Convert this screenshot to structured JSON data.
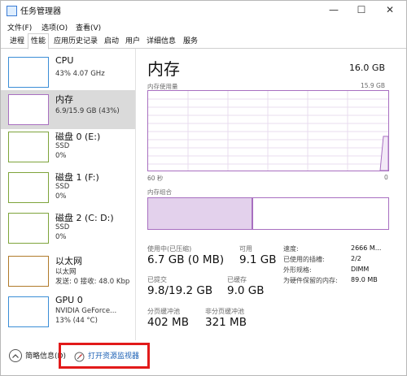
{
  "window": {
    "title": "任务管理器",
    "minimize": "—",
    "maximize": "☐",
    "close": "✕"
  },
  "menu": [
    "文件(F)",
    "选项(O)",
    "查看(V)"
  ],
  "tabs": [
    "进程",
    "性能",
    "应用历史记录",
    "启动",
    "用户",
    "详细信息",
    "服务"
  ],
  "active_tab": 1,
  "sidebar": [
    {
      "name": "CPU",
      "sub1": "43% 4.07 GHz",
      "sub2": "",
      "color": "#3b8ed6"
    },
    {
      "name": "内存",
      "sub1": "6.9/15.9 GB (43%)",
      "sub2": "",
      "color": "#a86fc0",
      "selected": true
    },
    {
      "name": "磁盘 0 (E:)",
      "sub1": "SSD",
      "sub2": "0%",
      "color": "#7ea43b"
    },
    {
      "name": "磁盘 1 (F:)",
      "sub1": "SSD",
      "sub2": "0%",
      "color": "#7ea43b"
    },
    {
      "name": "磁盘 2 (C: D:)",
      "sub1": "SSD",
      "sub2": "0%",
      "color": "#7ea43b"
    },
    {
      "name": "以太网",
      "sub1": "以太网",
      "sub2": "发送: 0 接收: 48.0 Kbp",
      "color": "#b07a2a"
    },
    {
      "name": "GPU 0",
      "sub1": "NVIDIA GeForce...",
      "sub2": "13% (44 °C)",
      "color": "#3b8ed6"
    }
  ],
  "main": {
    "title": "内存",
    "total": "16.0 GB",
    "graph_label": "内存使用量",
    "graph_max": "15.9 GB",
    "time_label": "60 秒",
    "time_zero": "0",
    "composition_label": "内存组合",
    "usage_fraction": 0.43
  },
  "stats": {
    "in_use_label": "使用中(已压缩)",
    "in_use": "6.7 GB (0 MB)",
    "available_label": "可用",
    "available": "9.1 GB",
    "committed_label": "已提交",
    "committed": "9.8/19.2 GB",
    "cached_label": "已缓存",
    "cached": "9.0 GB",
    "paged_pool_label": "分页缓冲池",
    "paged_pool": "402 MB",
    "nonpaged_pool_label": "非分页缓冲池",
    "nonpaged_pool": "321 MB"
  },
  "details": [
    {
      "k": "速度:",
      "v": "2666 M..."
    },
    {
      "k": "已使用的插槽:",
      "v": "2/2"
    },
    {
      "k": "外形规格:",
      "v": "DIMM"
    },
    {
      "k": "为硬件保留的内存:",
      "v": "89.0 MB"
    }
  ],
  "footer": {
    "brief_label": "简略信息(D)",
    "open_monitor_label": "打开资源监视器"
  }
}
